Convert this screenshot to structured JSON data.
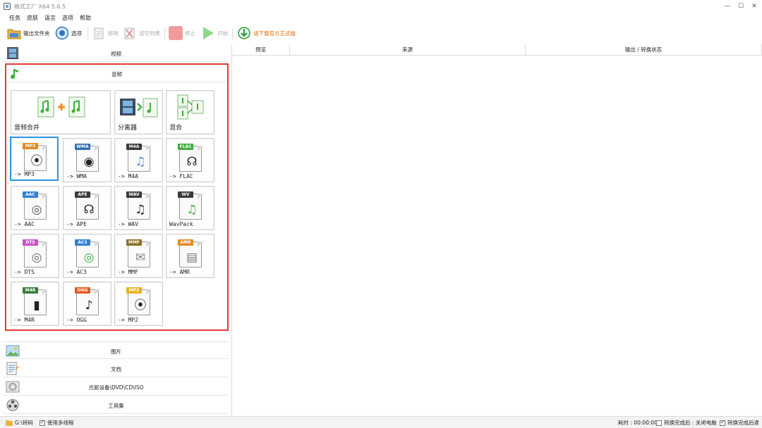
{
  "window": {
    "title": "格式工厂 X64 5.6.5",
    "minimize": "—",
    "maximize": "☐",
    "close": "✕"
  },
  "menu": [
    "任务",
    "皮肤",
    "语言",
    "选项",
    "帮助"
  ],
  "toolbar": {
    "output_folder": "输出文件夹",
    "options": "选项",
    "remove": "移除",
    "clear_list": "清空列表",
    "stop": "停止",
    "start": "开始",
    "download_official": "请下载官方正式版"
  },
  "categories": {
    "video": "视频",
    "audio": "音频",
    "image": "图片",
    "document": "文档",
    "disc": "光驱设备\\DVD\\CD\\ISO",
    "tools": "工具集"
  },
  "audio_tiles": {
    "merge": "音频合并",
    "splitter": "分离器",
    "mix": "混合",
    "formats": [
      {
        "tag": "MP3",
        "label": "-> MP3",
        "tag_color": "#e58a1f",
        "glyph": "disc-icon"
      },
      {
        "tag": "WMA",
        "label": "-> WMA",
        "tag_color": "#2f6db3",
        "glyph": "disc-icon"
      },
      {
        "tag": "M4A",
        "label": "-> M4A",
        "tag_color": "#3a3a3a",
        "glyph": "note-icon"
      },
      {
        "tag": "FLAC",
        "label": "-> FLAC",
        "tag_color": "#3fae3f",
        "glyph": "headphones-icon"
      },
      {
        "tag": "AAC",
        "label": "-> AAC",
        "tag_color": "#2f80d8",
        "glyph": "speaker-icon"
      },
      {
        "tag": "APE",
        "label": "-> APE",
        "tag_color": "#3a3a3a",
        "glyph": "headphones-icon"
      },
      {
        "tag": "WAV",
        "label": "-> WAV",
        "tag_color": "#3a3a3a",
        "glyph": "note-icon"
      },
      {
        "tag": "WV",
        "label": "WavPack",
        "tag_color": "#3a3a3a",
        "glyph": "note-icon"
      },
      {
        "tag": "DTS",
        "label": "-> DTS",
        "tag_color": "#c94fc9",
        "glyph": "speaker-icon"
      },
      {
        "tag": "AC3",
        "label": "-> AC3",
        "tag_color": "#2f80d8",
        "glyph": "speaker-icon"
      },
      {
        "tag": "MMF",
        "label": "-> MMF",
        "tag_color": "#8a6d2a",
        "glyph": "envelope-icon"
      },
      {
        "tag": "AMR",
        "label": "-> AMR",
        "tag_color": "#e58a1f",
        "glyph": "equalizer-icon"
      },
      {
        "tag": "M4R",
        "label": "-> M4R",
        "tag_color": "#3a7a3a",
        "glyph": "phone-icon"
      },
      {
        "tag": "OGG",
        "label": "-> OGG",
        "tag_color": "#e55a1f",
        "glyph": "note-icon"
      },
      {
        "tag": "MP2",
        "label": "-> MP2",
        "tag_color": "#e5b21f",
        "glyph": "disc-icon"
      }
    ]
  },
  "table": {
    "columns": [
      "预览",
      "来源",
      "输出 / 转换状态"
    ]
  },
  "statusbar": {
    "output_path": "G:\\转码",
    "multithread": "使用多线程",
    "elapsed_label": "耗时 : 00:00:00",
    "after_convert": "转换完成后 : 关闭电脑",
    "notify": "转换完成后通知"
  }
}
